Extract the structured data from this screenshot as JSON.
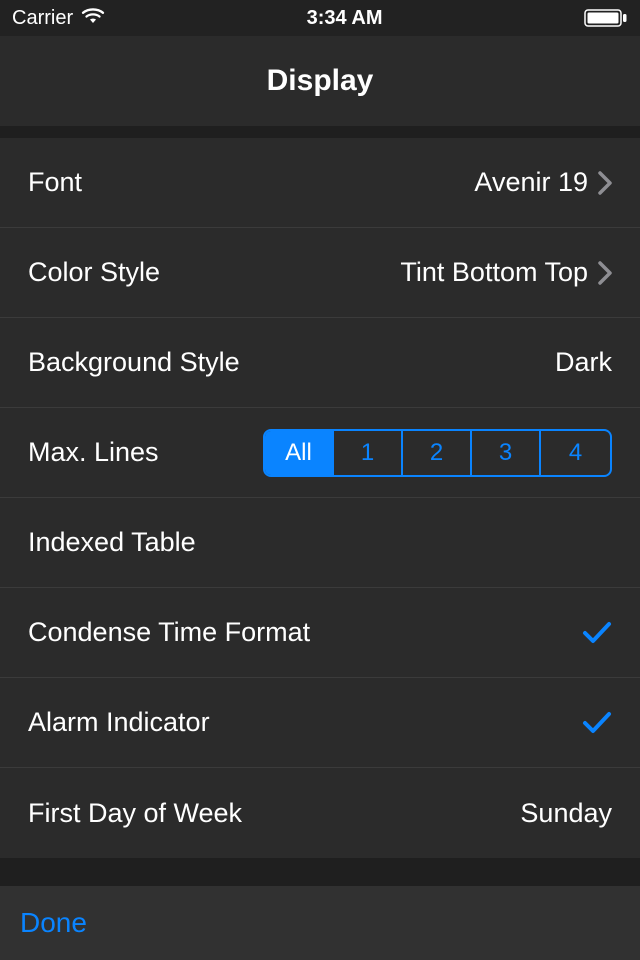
{
  "status_bar": {
    "carrier": "Carrier",
    "time": "3:34 AM"
  },
  "nav": {
    "title": "Display"
  },
  "rows": {
    "font": {
      "label": "Font",
      "value": "Avenir 19",
      "disclosure": true
    },
    "color_style": {
      "label": "Color Style",
      "value": "Tint Bottom Top",
      "disclosure": true
    },
    "bg_style": {
      "label": "Background Style",
      "value": "Dark",
      "disclosure": false
    },
    "max_lines": {
      "label": "Max. Lines",
      "options": [
        "All",
        "1",
        "2",
        "3",
        "4"
      ],
      "selected_index": 0
    },
    "indexed_table": {
      "label": "Indexed Table",
      "checked": false
    },
    "condense_time": {
      "label": "Condense Time Format",
      "checked": true
    },
    "alarm_ind": {
      "label": "Alarm Indicator",
      "checked": true
    },
    "first_day": {
      "label": "First Day of Week",
      "value": "Sunday"
    }
  },
  "toolbar": {
    "done": "Done"
  },
  "colors": {
    "accent": "#0a84ff"
  }
}
